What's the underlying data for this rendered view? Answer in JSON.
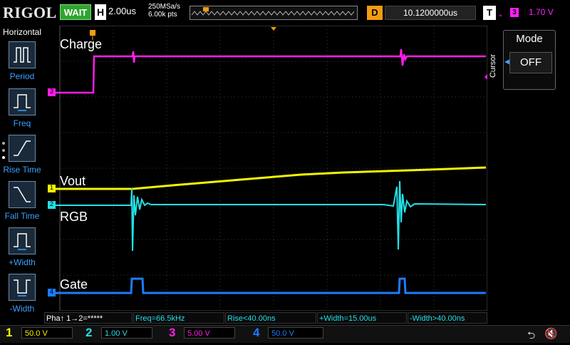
{
  "header": {
    "brand": "RIGOL",
    "run_state": "WAIT",
    "timebase_letter": "H",
    "timebase": "2.00us",
    "sample_rate": "250MSa/s",
    "memory_depth": "6.00k pts",
    "delay_letter": "D",
    "delay": "10.1200000us",
    "trigger_letter": "T",
    "trigger_channel": "3",
    "trigger_level": "1.70 V"
  },
  "left_panel": {
    "title": "Horizontal",
    "items": [
      {
        "label": "Period",
        "icon": "period-icon"
      },
      {
        "label": "Freq",
        "icon": "freq-icon"
      },
      {
        "label": "Rise Time",
        "icon": "rise-time-icon"
      },
      {
        "label": "Fall Time",
        "icon": "fall-time-icon"
      },
      {
        "label": "+Width",
        "icon": "pos-width-icon"
      },
      {
        "label": "-Width",
        "icon": "neg-width-icon"
      }
    ]
  },
  "traces": {
    "charge": {
      "label": "Charge",
      "marker": "3",
      "color": "#ff1ee8"
    },
    "vout": {
      "label": "Vout",
      "marker": "1",
      "color": "#f5f500"
    },
    "rgb": {
      "label": "RGB",
      "marker": "2",
      "color": "#22e0e6"
    },
    "gate": {
      "label": "Gate",
      "marker": "4",
      "color": "#1e7bff"
    }
  },
  "right_panel": {
    "side_label": "Cursor",
    "mode_title": "Mode",
    "mode_value": "OFF"
  },
  "measurements": [
    {
      "text": "Pha↑ 1→2=*****",
      "color": "#ffffff"
    },
    {
      "text": "Freq=66.5kHz",
      "color": "#22e0e6"
    },
    {
      "text": "Rise<40.00ns",
      "color": "#22e0e6"
    },
    {
      "text": "+Width=15.00us",
      "color": "#22e0e6"
    },
    {
      "text": "-Width>40.00ns",
      "color": "#22e0e6"
    }
  ],
  "channels": [
    {
      "num": "1",
      "scale": "50.0 V",
      "color": "#f5f500"
    },
    {
      "num": "2",
      "scale": "1.00 V",
      "color": "#22e0e6"
    },
    {
      "num": "3",
      "scale": "5.00 V",
      "color": "#ff1ee8"
    },
    {
      "num": "4",
      "scale": "50.0 V",
      "color": "#1e7bff"
    }
  ]
}
